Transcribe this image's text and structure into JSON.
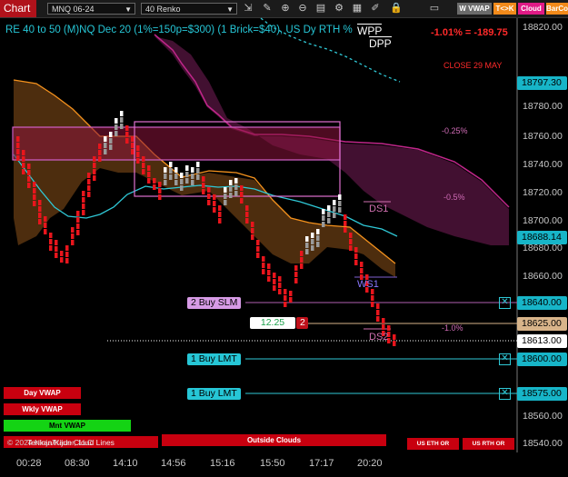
{
  "toolbar": {
    "chart_tab": "Chart",
    "instrument": "MNQ 06-24",
    "bar_type": "40 Renko",
    "icons": [
      "pointer-icon",
      "draw-tool-icon",
      "zoom-in-icon",
      "zoom-out-icon",
      "chart-properties-icon",
      "strategies-icon",
      "data-box-icon",
      "drawing-tools-icon",
      "lock-icon",
      "window-icon"
    ],
    "buttons": {
      "w_vwap": "W VWAP",
      "t_k": "T<>K",
      "cloud": "Cloud",
      "barco": "BarCo"
    }
  },
  "header": {
    "title": "RE 40 to 50 (M)NQ Dec 20 (1%=150p=$300) (1 Brick=$40), US Dy RTH %",
    "wpp": "WPP",
    "dpp": "DPP",
    "pct_change": "-1.01% = -189.75",
    "close_note": "CLOSE 29 MAY"
  },
  "chart_data": {
    "type": "line",
    "title": "RE 40 to 50 (M)NQ Dec 20 (1%=150p=$300) (1 Brick=$40), US Dy RTH %",
    "x_ticks": [
      "00:28",
      "08:30",
      "14:10",
      "14:56",
      "15:16",
      "15:50",
      "17:17",
      "20:20"
    ],
    "y_ticks": [
      18820.0,
      18780.0,
      18760.0,
      18740.0,
      18720.0,
      18700.0,
      18680.0,
      18660.0,
      18640.0,
      18620.0,
      18600.0,
      18580.0,
      18560.0,
      18540.0
    ],
    "ylim": [
      18535,
      18830
    ],
    "price_tags": [
      {
        "label": "18797.30",
        "value": 18797.3,
        "color": "#17b5c8"
      },
      {
        "label": "18688.14",
        "value": 18688.14,
        "color": "#17b5c8"
      },
      {
        "label": "18640.00",
        "value": 18640.0,
        "color": "#17b5c8"
      },
      {
        "label": "18625.00",
        "value": 18625.0,
        "color": "#d8b48a"
      },
      {
        "label": "18613.00",
        "value": 18613.0,
        "color": "#ffffff"
      },
      {
        "label": "18600.00",
        "value": 18600.0,
        "color": "#17b5c8"
      },
      {
        "label": "18575.00",
        "value": 18575.0,
        "color": "#17b5c8"
      }
    ],
    "level_labels": [
      {
        "text": "-0.25%",
        "value": 18762
      },
      {
        "text": "-0.5%",
        "value": 18718
      },
      {
        "text": "DS1",
        "value": 18704
      },
      {
        "text": "WS1",
        "value": 18644
      },
      {
        "text": "-1.0%",
        "value": 18625
      },
      {
        "text": "DS2",
        "value": 18615
      }
    ],
    "series": [
      {
        "name": "Renko Bricks",
        "color": "#e8151c"
      }
    ]
  },
  "orders": {
    "buy_slm": {
      "label": "2 Buy SLM",
      "price": 18640.0
    },
    "position": {
      "price": "12.25",
      "qty": "2"
    },
    "buy_lmt_1": {
      "label": "1 Buy LMT",
      "price": 18600.0
    },
    "buy_lmt_2": {
      "label": "1 Buy LMT",
      "price": 18575.0
    }
  },
  "buttons": {
    "day_vwap": "Day VWAP",
    "wkly_vwap": "Wkly VWAP",
    "mnt_vwap": "Mnt VWAP",
    "outside_clouds": "Outside Clouds",
    "us_eth_or": "US ETH OR",
    "us_rth_or": "US RTH OR"
  },
  "footer": {
    "copyright": "© 2024 NinjaTrader, LLC",
    "overlay_text": "Tenkan/Kijun Cloud Lines"
  }
}
